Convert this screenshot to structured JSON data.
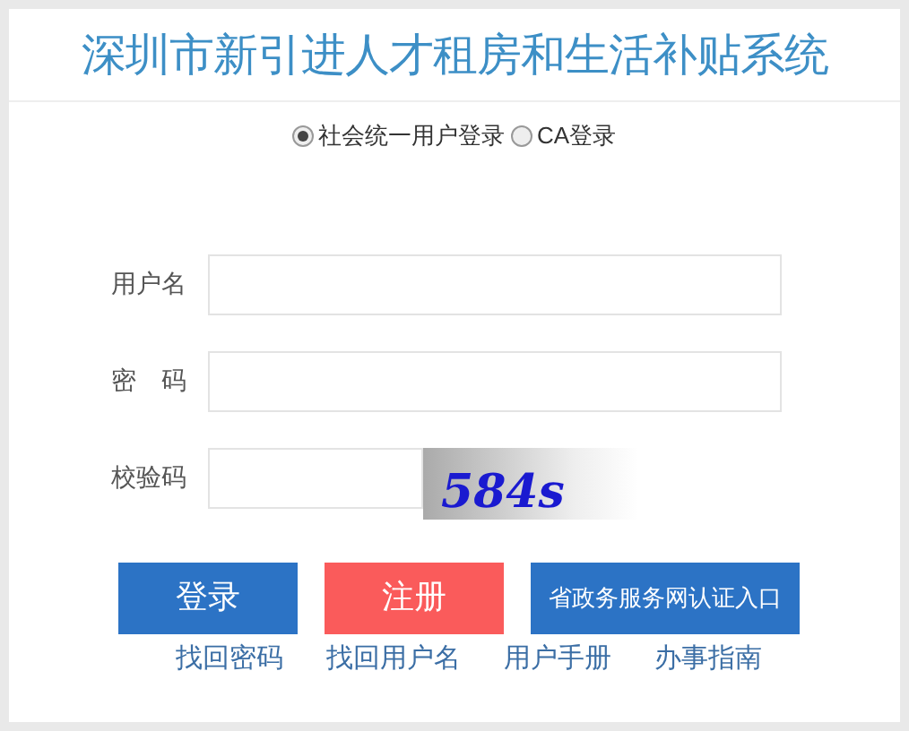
{
  "title": "深圳市新引进人才租房和生活补贴系统",
  "login_modes": [
    {
      "label": "社会统一用户登录",
      "selected": true
    },
    {
      "label": "CA登录",
      "selected": false
    }
  ],
  "fields": [
    {
      "kind": "text",
      "label": "用户名"
    },
    {
      "kind": "password",
      "label": "密　码"
    },
    {
      "kind": "captcha",
      "label": "校验码",
      "captcha": "584s"
    }
  ],
  "buttons": [
    {
      "kind": "primary",
      "label": "登录"
    },
    {
      "kind": "danger",
      "label": "注册"
    },
    {
      "kind": "primary-small",
      "label": "省政务服务网认证入口"
    }
  ],
  "links": [
    "找回密码",
    "找回用户名",
    "用户手册",
    "办事指南"
  ]
}
